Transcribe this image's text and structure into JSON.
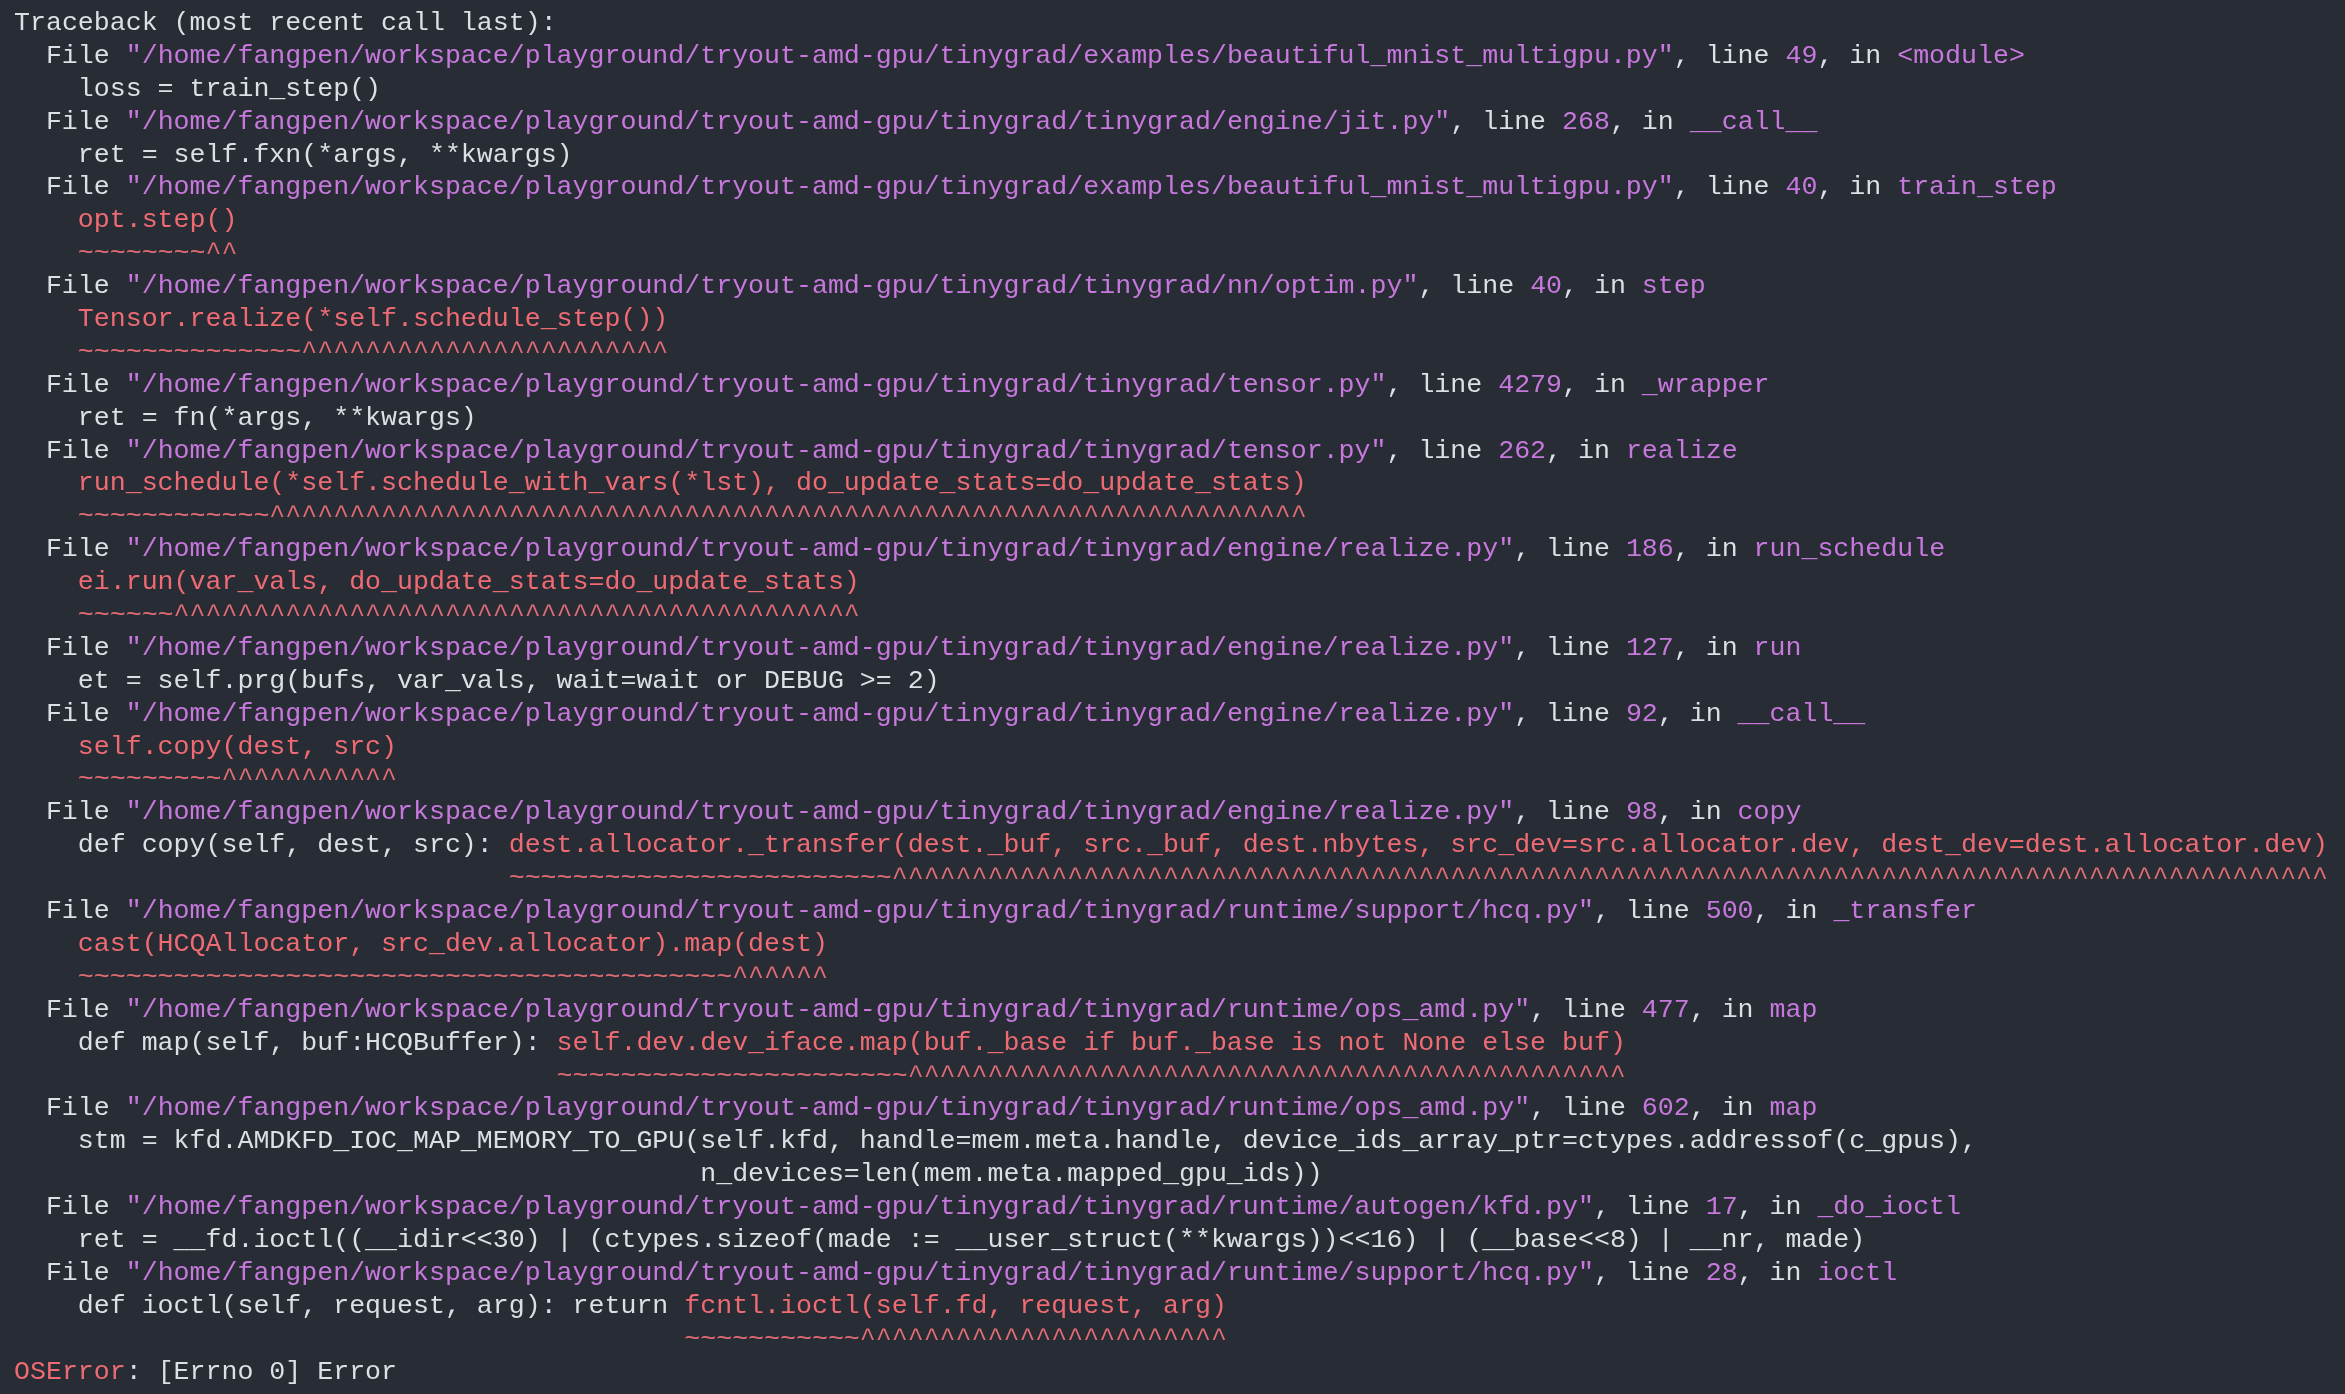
{
  "header": "Traceback (most recent call last):",
  "frames": [
    {
      "file_label": "File",
      "path": "\"/home/fangpen/workspace/playground/tryout-amd-gpu/tinygrad/examples/beautiful_mnist_multigpu.py\"",
      "line_label": ", line",
      "line": "49",
      "in_label": ", in",
      "function": "<module>",
      "code": [
        {
          "plain": "loss = train_step()"
        }
      ]
    },
    {
      "file_label": "File",
      "path": "\"/home/fangpen/workspace/playground/tryout-amd-gpu/tinygrad/tinygrad/engine/jit.py\"",
      "line_label": ", line",
      "line": "268",
      "in_label": ", in",
      "function": "__call__",
      "code": [
        {
          "plain": "ret = self.fxn(*args, **kwargs)"
        }
      ]
    },
    {
      "file_label": "File",
      "path": "\"/home/fangpen/workspace/playground/tryout-amd-gpu/tinygrad/examples/beautiful_mnist_multigpu.py\"",
      "line_label": ", line",
      "line": "40",
      "in_label": ", in",
      "function": "train_step",
      "code": [
        {
          "highlight": "opt.step()"
        }
      ],
      "marker": "~~~~~~~~^^"
    },
    {
      "file_label": "File",
      "path": "\"/home/fangpen/workspace/playground/tryout-amd-gpu/tinygrad/tinygrad/nn/optim.py\"",
      "line_label": ", line",
      "line": "40",
      "in_label": ", in",
      "function": "step",
      "code": [
        {
          "highlight": "Tensor.realize(*self.schedule_step())"
        }
      ],
      "marker": "~~~~~~~~~~~~~~^^^^^^^^^^^^^^^^^^^^^^^"
    },
    {
      "file_label": "File",
      "path": "\"/home/fangpen/workspace/playground/tryout-amd-gpu/tinygrad/tinygrad/tensor.py\"",
      "line_label": ", line",
      "line": "4279",
      "in_label": ", in",
      "function": "_wrapper",
      "code": [
        {
          "plain": "ret = fn(*args, **kwargs)"
        }
      ]
    },
    {
      "file_label": "File",
      "path": "\"/home/fangpen/workspace/playground/tryout-amd-gpu/tinygrad/tinygrad/tensor.py\"",
      "line_label": ", line",
      "line": "262",
      "in_label": ", in",
      "function": "realize",
      "code": [
        {
          "highlight": "run_schedule(*self.schedule_with_vars(*lst), do_update_stats=do_update_stats)"
        }
      ],
      "marker": "~~~~~~~~~~~~^^^^^^^^^^^^^^^^^^^^^^^^^^^^^^^^^^^^^^^^^^^^^^^^^^^^^^^^^^^^^^^^^"
    },
    {
      "file_label": "File",
      "path": "\"/home/fangpen/workspace/playground/tryout-amd-gpu/tinygrad/tinygrad/engine/realize.py\"",
      "line_label": ", line",
      "line": "186",
      "in_label": ", in",
      "function": "run_schedule",
      "code": [
        {
          "highlight": "ei.run(var_vals, do_update_stats=do_update_stats)"
        }
      ],
      "marker": "~~~~~~^^^^^^^^^^^^^^^^^^^^^^^^^^^^^^^^^^^^^^^^^^^"
    },
    {
      "file_label": "File",
      "path": "\"/home/fangpen/workspace/playground/tryout-amd-gpu/tinygrad/tinygrad/engine/realize.py\"",
      "line_label": ", line",
      "line": "127",
      "in_label": ", in",
      "function": "run",
      "code": [
        {
          "plain": "et = self.prg(bufs, var_vals, wait=wait or DEBUG >= 2)"
        }
      ]
    },
    {
      "file_label": "File",
      "path": "\"/home/fangpen/workspace/playground/tryout-amd-gpu/tinygrad/tinygrad/engine/realize.py\"",
      "line_label": ", line",
      "line": "92",
      "in_label": ", in",
      "function": "__call__",
      "code": [
        {
          "highlight": "self.copy(dest, src)"
        }
      ],
      "marker": "~~~~~~~~~^^^^^^^^^^^"
    },
    {
      "file_label": "File",
      "path": "\"/home/fangpen/workspace/playground/tryout-amd-gpu/tinygrad/tinygrad/engine/realize.py\"",
      "line_label": ", line",
      "line": "98",
      "in_label": ", in",
      "function": "copy",
      "code": [
        {
          "plain": "def copy(self, dest, src): ",
          "highlight": "dest.allocator._transfer(dest._buf, src._buf, dest.nbytes, src_dev=src.allocator.dev, dest_dev=dest.allocator.dev)"
        }
      ],
      "marker": "~~~~~~~~~~~~~~~~~~~~~~~~^^^^^^^^^^^^^^^^^^^^^^^^^^^^^^^^^^^^^^^^^^^^^^^^^^^^^^^^^^^^^^^^^^^^^^^^^^^^^^^^^^^^^^^^^^"
    },
    {
      "file_label": "File",
      "path": "\"/home/fangpen/workspace/playground/tryout-amd-gpu/tinygrad/tinygrad/runtime/support/hcq.py\"",
      "line_label": ", line",
      "line": "500",
      "in_label": ", in",
      "function": "_transfer",
      "code": [
        {
          "highlight": "cast(HCQAllocator, src_dev.allocator).map(dest)"
        }
      ],
      "marker": "~~~~~~~~~~~~~~~~~~~~~~~~~~~~~~~~~~~~~~~~~^^^^^^"
    },
    {
      "file_label": "File",
      "path": "\"/home/fangpen/workspace/playground/tryout-amd-gpu/tinygrad/tinygrad/runtime/ops_amd.py\"",
      "line_label": ", line",
      "line": "477",
      "in_label": ", in",
      "function": "map",
      "code": [
        {
          "plain": "def map(self, buf:HCQBuffer): ",
          "highlight": "self.dev.dev_iface.map(buf._base if buf._base is not None else buf)"
        }
      ],
      "marker": "~~~~~~~~~~~~~~~~~~~~~~^^^^^^^^^^^^^^^^^^^^^^^^^^^^^^^^^^^^^^^^^^^^^"
    },
    {
      "file_label": "File",
      "path": "\"/home/fangpen/workspace/playground/tryout-amd-gpu/tinygrad/tinygrad/runtime/ops_amd.py\"",
      "line_label": ", line",
      "line": "602",
      "in_label": ", in",
      "function": "map",
      "code": [
        {
          "plain": "stm = kfd.AMDKFD_IOC_MAP_MEMORY_TO_GPU(self.kfd, handle=mem.meta.handle, device_ids_array_ptr=ctypes.addressof(c_gpus),"
        },
        {
          "plain": "                                       n_devices=len(mem.meta.mapped_gpu_ids))"
        }
      ]
    },
    {
      "file_label": "File",
      "path": "\"/home/fangpen/workspace/playground/tryout-amd-gpu/tinygrad/tinygrad/runtime/autogen/kfd.py\"",
      "line_label": ", line",
      "line": "17",
      "in_label": ", in",
      "function": "_do_ioctl",
      "code": [
        {
          "plain": "ret = __fd.ioctl((__idir<<30) | (ctypes.sizeof(made := __user_struct(**kwargs))<<16) | (__base<<8) | __nr, made)"
        }
      ]
    },
    {
      "file_label": "File",
      "path": "\"/home/fangpen/workspace/playground/tryout-amd-gpu/tinygrad/tinygrad/runtime/support/hcq.py\"",
      "line_label": ", line",
      "line": "28",
      "in_label": ", in",
      "function": "ioctl",
      "code": [
        {
          "plain": "def ioctl(self, request, arg): return ",
          "highlight": "fcntl.ioctl(self.fd, request, arg)"
        }
      ],
      "marker": "~~~~~~~~~~~^^^^^^^^^^^^^^^^^^^^^^^"
    }
  ],
  "error": {
    "type": "OSError",
    "message": ": [Errno 0] Error"
  }
}
